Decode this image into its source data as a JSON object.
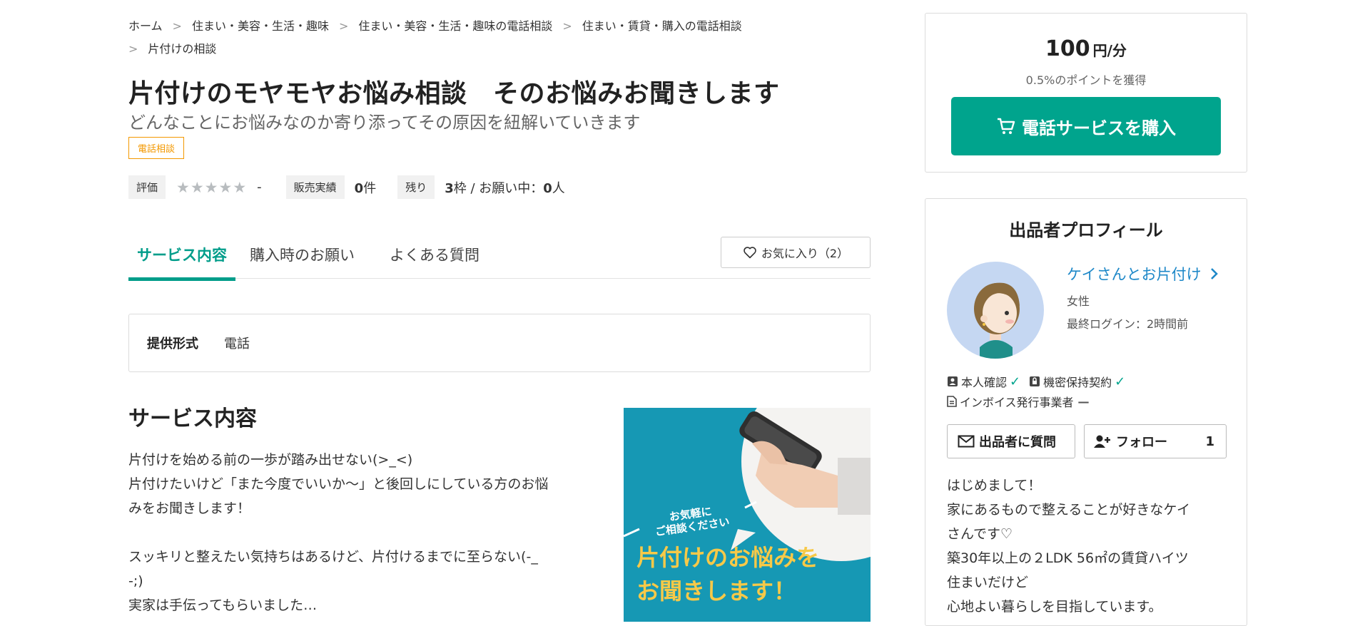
{
  "breadcrumb": {
    "items": [
      "ホーム",
      "住まい・美容・生活・趣味",
      "住まい・美容・生活・趣味の電話相談",
      "住まい・賃貸・購入の電話相談",
      "片付けの相談"
    ]
  },
  "service": {
    "title": "片付けのモヤモヤお悩み相談　そのお悩みお聞きします",
    "subtitle": "どんなことにお悩みなのか寄り添ってその原因を紐解いていきます",
    "tag": "電話相談",
    "rating_label": "評価",
    "rating_stars": "★★★★★",
    "rating_value": "-",
    "sales_label": "販売実績",
    "sales_count": "0",
    "sales_unit": "件",
    "remaining_label": "残り",
    "remaining_count": "3",
    "remaining_unit": "枠 / お願い中：",
    "requests_count": "0",
    "requests_unit": "人"
  },
  "tabs": [
    {
      "label": "サービス内容",
      "active": true
    },
    {
      "label": "購入時のお願い",
      "active": false
    },
    {
      "label": "よくある質問",
      "active": false
    }
  ],
  "favorite": {
    "label": "お気に入り（2）"
  },
  "format": {
    "label": "提供形式",
    "value": "電話"
  },
  "content": {
    "section_title": "サービス内容",
    "paragraphs": [
      "片付けを始める前の一歩が踏み出せない(>_<)",
      "片付けたいけど「また今度でいいか〜」と後回しにしている方のお悩",
      "みをお聞きします！",
      "",
      "スッキリと整えたい気持ちはあるけど、片付けるまでに至らない(-_",
      "-;)",
      "実家は手伝ってもらいました…"
    ],
    "hero_small": "お気軽に\nご相談ください",
    "hero_big_1": "片付けのお悩みを",
    "hero_big_2": "お聞きします！"
  },
  "purchase": {
    "price": "100",
    "unit": "円/分",
    "points": "0.5%のポイントを獲得",
    "buy_label": "電話サービスを購入"
  },
  "profile": {
    "title": "出品者プロフィール",
    "name": "ケイさんとお片付け",
    "gender": "女性",
    "last_login": "最終ログイン：2時間前",
    "verified_id": "本人確認",
    "nda": "機密保持契約",
    "invoice": "インボイス発行事業者",
    "question_button": "出品者に質問",
    "follow_button": "フォロー",
    "follow_count": "1",
    "intro": [
      "はじめまして！",
      "家にあるもので整えることが好きなケイ",
      "さんです♡",
      "築30年以上の２LDK 56㎡の賃貸ハイツ",
      "住まいだけど",
      "心地よい暮らしを目指しています。"
    ]
  },
  "colors": {
    "accent": "#00a48d",
    "link": "#1e88c8",
    "tag": "#f39800",
    "hero_bg": "#1698b4",
    "hero_text": "#f7c948"
  }
}
